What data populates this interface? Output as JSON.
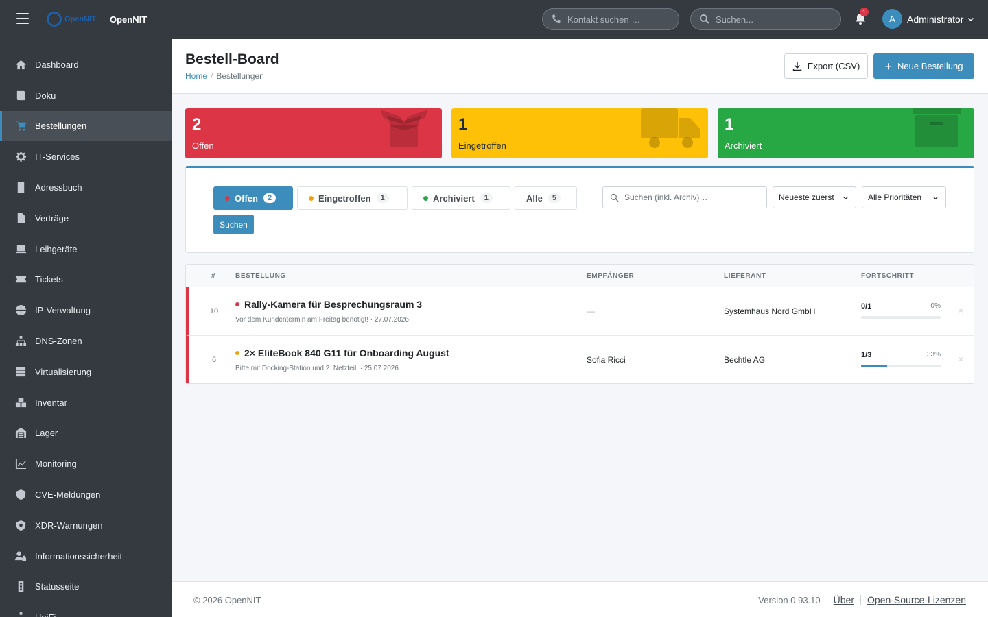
{
  "app": {
    "brand_logo_text": "OpenNIT",
    "brand_name": "OpenNIT"
  },
  "topbar": {
    "contact_search_placeholder": "Kontakt suchen …",
    "search_placeholder": "Suchen...",
    "notification_count": "1",
    "user_initial": "A",
    "user_name": "Administrator"
  },
  "sidebar": {
    "items": [
      {
        "label": "Dashboard",
        "icon": "home-icon"
      },
      {
        "label": "Doku",
        "icon": "book-icon"
      },
      {
        "label": "Bestellungen",
        "icon": "cart-icon",
        "active": true
      },
      {
        "label": "IT-Services",
        "icon": "gear-icon"
      },
      {
        "label": "Adressbuch",
        "icon": "address-book-icon"
      },
      {
        "label": "Verträge",
        "icon": "contract-icon"
      },
      {
        "label": "Leihgeräte",
        "icon": "laptop-icon"
      },
      {
        "label": "Tickets",
        "icon": "ticket-icon"
      },
      {
        "label": "IP-Verwaltung",
        "icon": "globe-icon"
      },
      {
        "label": "DNS-Zonen",
        "icon": "sitemap-icon"
      },
      {
        "label": "Virtualisierung",
        "icon": "server-icon"
      },
      {
        "label": "Inventar",
        "icon": "boxes-icon"
      },
      {
        "label": "Lager",
        "icon": "warehouse-icon"
      },
      {
        "label": "Monitoring",
        "icon": "chart-line-icon"
      },
      {
        "label": "CVE-Meldungen",
        "icon": "shield-icon"
      },
      {
        "label": "XDR-Warnungen",
        "icon": "shield-virus-icon"
      },
      {
        "label": "Informationssicherheit",
        "icon": "user-lock-icon"
      },
      {
        "label": "Statusseite",
        "icon": "traffic-light-icon"
      },
      {
        "label": "UniFi",
        "icon": "network-icon"
      }
    ]
  },
  "header": {
    "title": "Bestell-Board",
    "breadcrumb": {
      "home": "Home",
      "current": "Bestellungen"
    },
    "export_label": "Export (CSV)",
    "new_label": "Neue Bestellung"
  },
  "stats": {
    "open": {
      "value": "2",
      "label": "Offen"
    },
    "arrived": {
      "value": "1",
      "label": "Eingetroffen"
    },
    "archived": {
      "value": "1",
      "label": "Archiviert"
    }
  },
  "filters": {
    "tabs": [
      {
        "label": "Offen",
        "count": "2",
        "active": true,
        "dot_color": "#dc3545"
      },
      {
        "label": "Eingetroffen",
        "count": "1",
        "dot_color": "#f0a30a"
      },
      {
        "label": "Archiviert",
        "count": "1",
        "dot_color": "#28a745"
      },
      {
        "label": "Alle",
        "count": "5"
      }
    ],
    "search_placeholder": "Suchen (inkl. Archiv)…",
    "sort_value": "Neueste zuerst",
    "priority_value": "Alle Prioritäten",
    "search_button": "Suchen"
  },
  "table": {
    "columns": {
      "num": "#",
      "order": "BESTELLUNG",
      "recipient": "EMPFÄNGER",
      "supplier": "LIEFERANT",
      "progress": "FORTSCHRITT"
    },
    "rows": [
      {
        "num": "10",
        "title": "Rally-Kamera für Besprechungsraum 3",
        "dot_color": "#dc3545",
        "subtitle": "Vor dem Kundentermin am Freitag benötigt! · 27.07.2026",
        "recipient": "—",
        "supplier": "Systemhaus Nord GmbH",
        "progress_count": "0/1",
        "progress_pct": "0%",
        "progress_value": 0,
        "remove": "×"
      },
      {
        "num": "6",
        "title": "2× EliteBook 840 G11 für Onboarding August",
        "dot_color": "#f0a30a",
        "subtitle": "Bitte mit Docking-Station und 2. Netzteil. · 25.07.2026",
        "recipient": "Sofia Ricci",
        "supplier": "Bechtle AG",
        "progress_count": "1/3",
        "progress_pct": "33%",
        "progress_value": 33,
        "remove": "×"
      }
    ]
  },
  "footer": {
    "copyright": "© 2026 OpenNIT",
    "version": "Version 0.93.10",
    "about": "Über",
    "licenses": "Open-Source-Lizenzen"
  },
  "colors": {
    "accent": "#3c8dbc",
    "danger": "#dc3545",
    "warning": "#ffc107",
    "success": "#28a745"
  }
}
